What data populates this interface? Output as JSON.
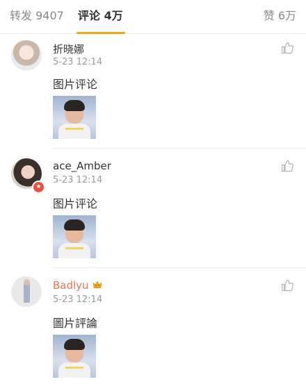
{
  "tabs": {
    "repost": {
      "label": "转发",
      "count": "9407"
    },
    "comments": {
      "label": "评论",
      "count": "4万"
    },
    "likes": {
      "label": "赞",
      "count": "6万"
    }
  },
  "comments": [
    {
      "username": "折晓娜",
      "time": "5-23 12:14",
      "text": "图片评论",
      "avatar_icon": "avatar-image",
      "image_icon": "comment-image"
    },
    {
      "username": "ace_Amber",
      "time": "5-23 12:14",
      "text": "图片评论",
      "avatar_icon": "avatar-image",
      "badge_icon": "verified-badge-icon",
      "image_icon": "comment-image"
    },
    {
      "username": "Badlyu",
      "time": "5-23 12:14",
      "text": "圖片評論",
      "avatar_icon": "avatar-image",
      "crown_icon": "crown-icon",
      "image_icon": "comment-image"
    }
  ],
  "colors": {
    "accent_underline": "#f7a31a",
    "vip_name": "#eb7350",
    "secondary_text": "#9a9a9a"
  }
}
